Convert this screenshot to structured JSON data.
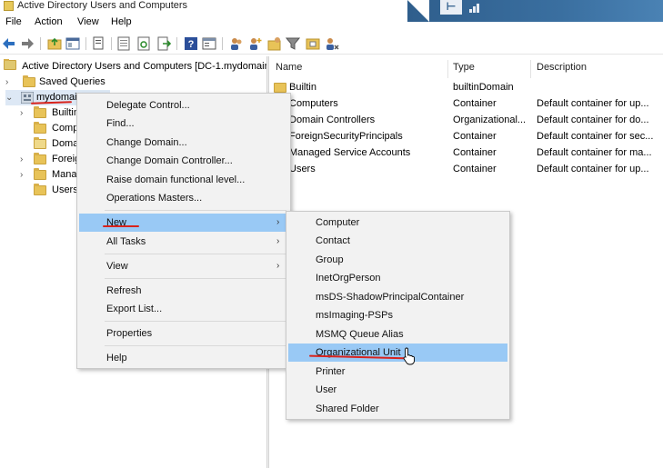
{
  "window": {
    "title": "Active Directory Users and Computers"
  },
  "menubar": [
    "File",
    "Action",
    "View",
    "Help"
  ],
  "toolbar": {
    "icons": [
      "back-icon",
      "forward-icon",
      "up-folder-icon",
      "show-hide-console-tree-icon",
      "copy-icon",
      "export-list-icon",
      "refresh-icon",
      "export-icon",
      "help-icon",
      "properties-icon",
      "users-icon",
      "add-user-icon",
      "add-group-icon",
      "filter-icon",
      "ou-icon",
      "delegate-icon"
    ]
  },
  "tree": {
    "root": "Active Directory Users and Computers [DC-1.mydomain",
    "items": [
      {
        "label": "Saved Queries",
        "expander": "›"
      },
      {
        "label": "mydomain",
        "expander": "⌄"
      },
      {
        "label": "Builtin",
        "expander": "›"
      },
      {
        "label": "Computers",
        "expander": ""
      },
      {
        "label": "Domain Controllers",
        "expander": ""
      },
      {
        "label": "ForeignSecurityPrincipals",
        "expander": "›"
      },
      {
        "label": "Managed Service Accounts",
        "expander": "›"
      },
      {
        "label": "Users",
        "expander": ""
      }
    ]
  },
  "list": {
    "columns": [
      "Name",
      "Type",
      "Description"
    ],
    "rows": [
      {
        "name": "Builtin",
        "type": "builtinDomain",
        "description": ""
      },
      {
        "name": "Computers",
        "type": "Container",
        "description": "Default container for up..."
      },
      {
        "name": "Domain Controllers",
        "type": "Organizational...",
        "description": "Default container for do..."
      },
      {
        "name": "ForeignSecurityPrincipals",
        "type": "Container",
        "description": "Default container for sec..."
      },
      {
        "name": "Managed Service Accounts",
        "type": "Container",
        "description": "Default container for ma..."
      },
      {
        "name": "Users",
        "type": "Container",
        "description": "Default container for up..."
      }
    ]
  },
  "context_menu": {
    "items": [
      "Delegate Control...",
      "Find...",
      "Change Domain...",
      "Change Domain Controller...",
      "Raise domain functional level...",
      "Operations Masters...",
      "New",
      "All Tasks",
      "View",
      "Refresh",
      "Export List...",
      "Properties",
      "Help"
    ],
    "submenu_arrow": "›",
    "highlighted": "New"
  },
  "submenu": {
    "items": [
      "Computer",
      "Contact",
      "Group",
      "InetOrgPerson",
      "msDS-ShadowPrincipalContainer",
      "msImaging-PSPs",
      "MSMQ Queue Alias",
      "Organizational Unit",
      "Printer",
      "User",
      "Shared Folder"
    ],
    "highlighted": "Organizational Unit"
  },
  "colors": {
    "highlight": "#99c9f5",
    "annotation_red": "#d8231c",
    "remote_banner": "#2f5e8c"
  }
}
